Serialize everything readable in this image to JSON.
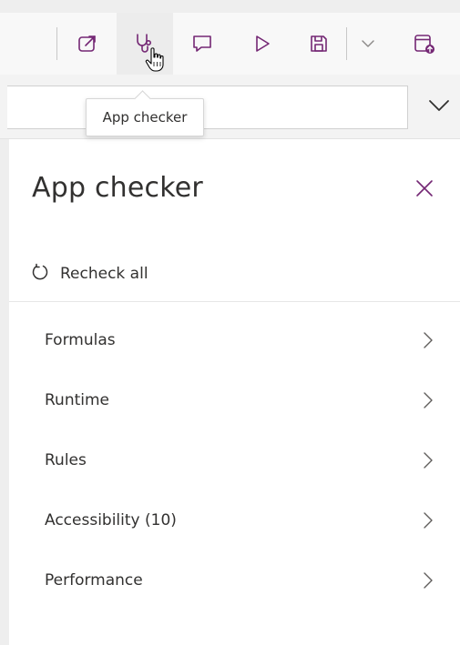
{
  "toolbar": {
    "buttons": [
      {
        "name": "share-icon"
      },
      {
        "name": "stethoscope-icon",
        "active": true
      },
      {
        "name": "comment-icon"
      },
      {
        "name": "play-icon"
      },
      {
        "name": "save-icon"
      },
      {
        "name": "chevron-down-icon"
      },
      {
        "name": "publish-icon"
      }
    ],
    "accent_color": "#742774"
  },
  "tooltip": {
    "text": "App checker"
  },
  "panel": {
    "title": "App checker",
    "recheck_label": "Recheck all",
    "categories": [
      {
        "label": "Formulas"
      },
      {
        "label": "Runtime"
      },
      {
        "label": "Rules"
      },
      {
        "label": "Accessibility (10)"
      },
      {
        "label": "Performance"
      }
    ]
  }
}
